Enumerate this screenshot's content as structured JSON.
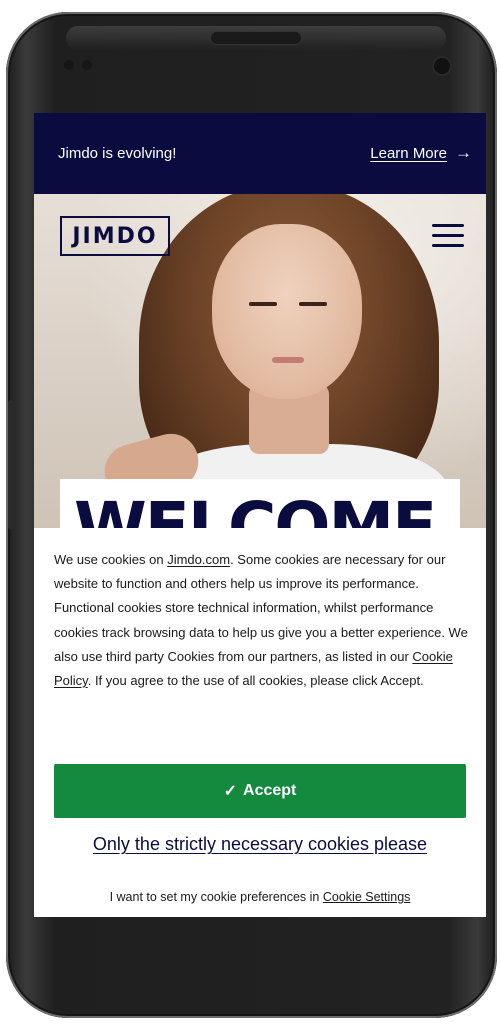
{
  "banner": {
    "text": "Jimdo is evolving!",
    "link_label": "Learn More",
    "arrow": "→"
  },
  "header": {
    "logo_text": "JIMDO",
    "menu_icon": "hamburger-menu-icon"
  },
  "hero": {
    "headline": "WELCOME"
  },
  "cookie_banner": {
    "text_before_link1": "We use cookies on ",
    "link1": "Jimdo.com",
    "text_middle": ". Some cookies are necessary for our website to function and others help us improve its performance. Functional cookies store technical information, whilst performance cookies track browsing data to help us give you a better experience. We also use third party Cookies from our partners, as listed in our ",
    "link2": "Cookie Policy",
    "text_after_link2": ". If you agree to the use of all cookies, please click Accept.",
    "accept_check": "✓",
    "accept_label": "Accept",
    "necessary_label": "Only the strictly necessary cookies please",
    "prefs_text": "I want to set my cookie preferences in ",
    "prefs_link": "Cookie Settings"
  },
  "colors": {
    "navy": "#0a0b3f",
    "accept_green": "#138a3e"
  }
}
